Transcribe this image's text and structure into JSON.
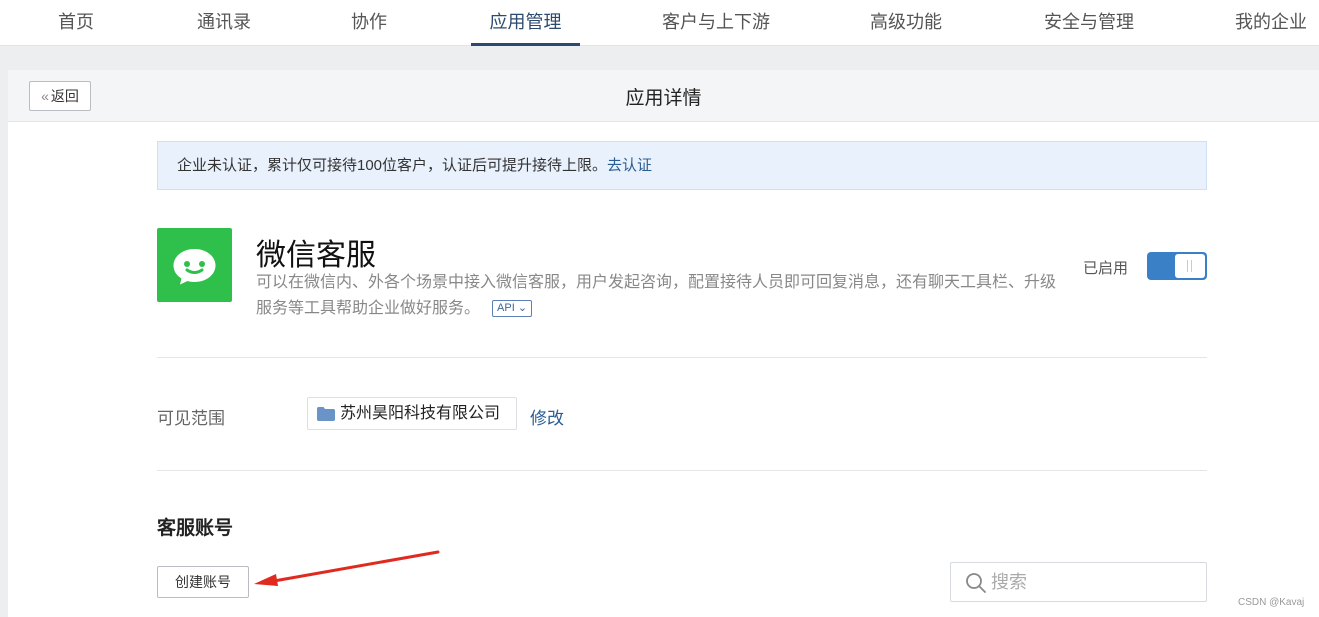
{
  "nav": {
    "items": [
      {
        "label": "首页",
        "active": false
      },
      {
        "label": "通讯录",
        "active": false
      },
      {
        "label": "协作",
        "active": false
      },
      {
        "label": "应用管理",
        "active": true
      },
      {
        "label": "客户与上下游",
        "active": false
      },
      {
        "label": "高级功能",
        "active": false
      },
      {
        "label": "安全与管理",
        "active": false
      },
      {
        "label": "我的企业",
        "active": false
      }
    ]
  },
  "header": {
    "back_label": "返回",
    "title": "应用详情"
  },
  "notice": {
    "text": "企业未认证，累计仅可接待100位客户，认证后可提升接待上限。",
    "link": "去认证"
  },
  "app": {
    "icon": "chat-bubble-icon",
    "name": "微信客服",
    "description": "可以在微信内、外各个场景中接入微信客服，用户发起咨询，配置接待人员即可回复消息，还有聊天工具栏、升级服务等工具帮助企业做好服务。",
    "api_tag": "API",
    "status_label": "已启用",
    "enabled": true,
    "icon_color": "#2fc04c",
    "accent_color": "#3a80c6"
  },
  "scope": {
    "label": "可见范围",
    "value": "苏州昊阳科技有限公司",
    "edit_label": "修改"
  },
  "accounts": {
    "title": "客服账号",
    "create_label": "创建账号",
    "search_placeholder": "搜索"
  },
  "watermark": "CSDN @Kavaj"
}
